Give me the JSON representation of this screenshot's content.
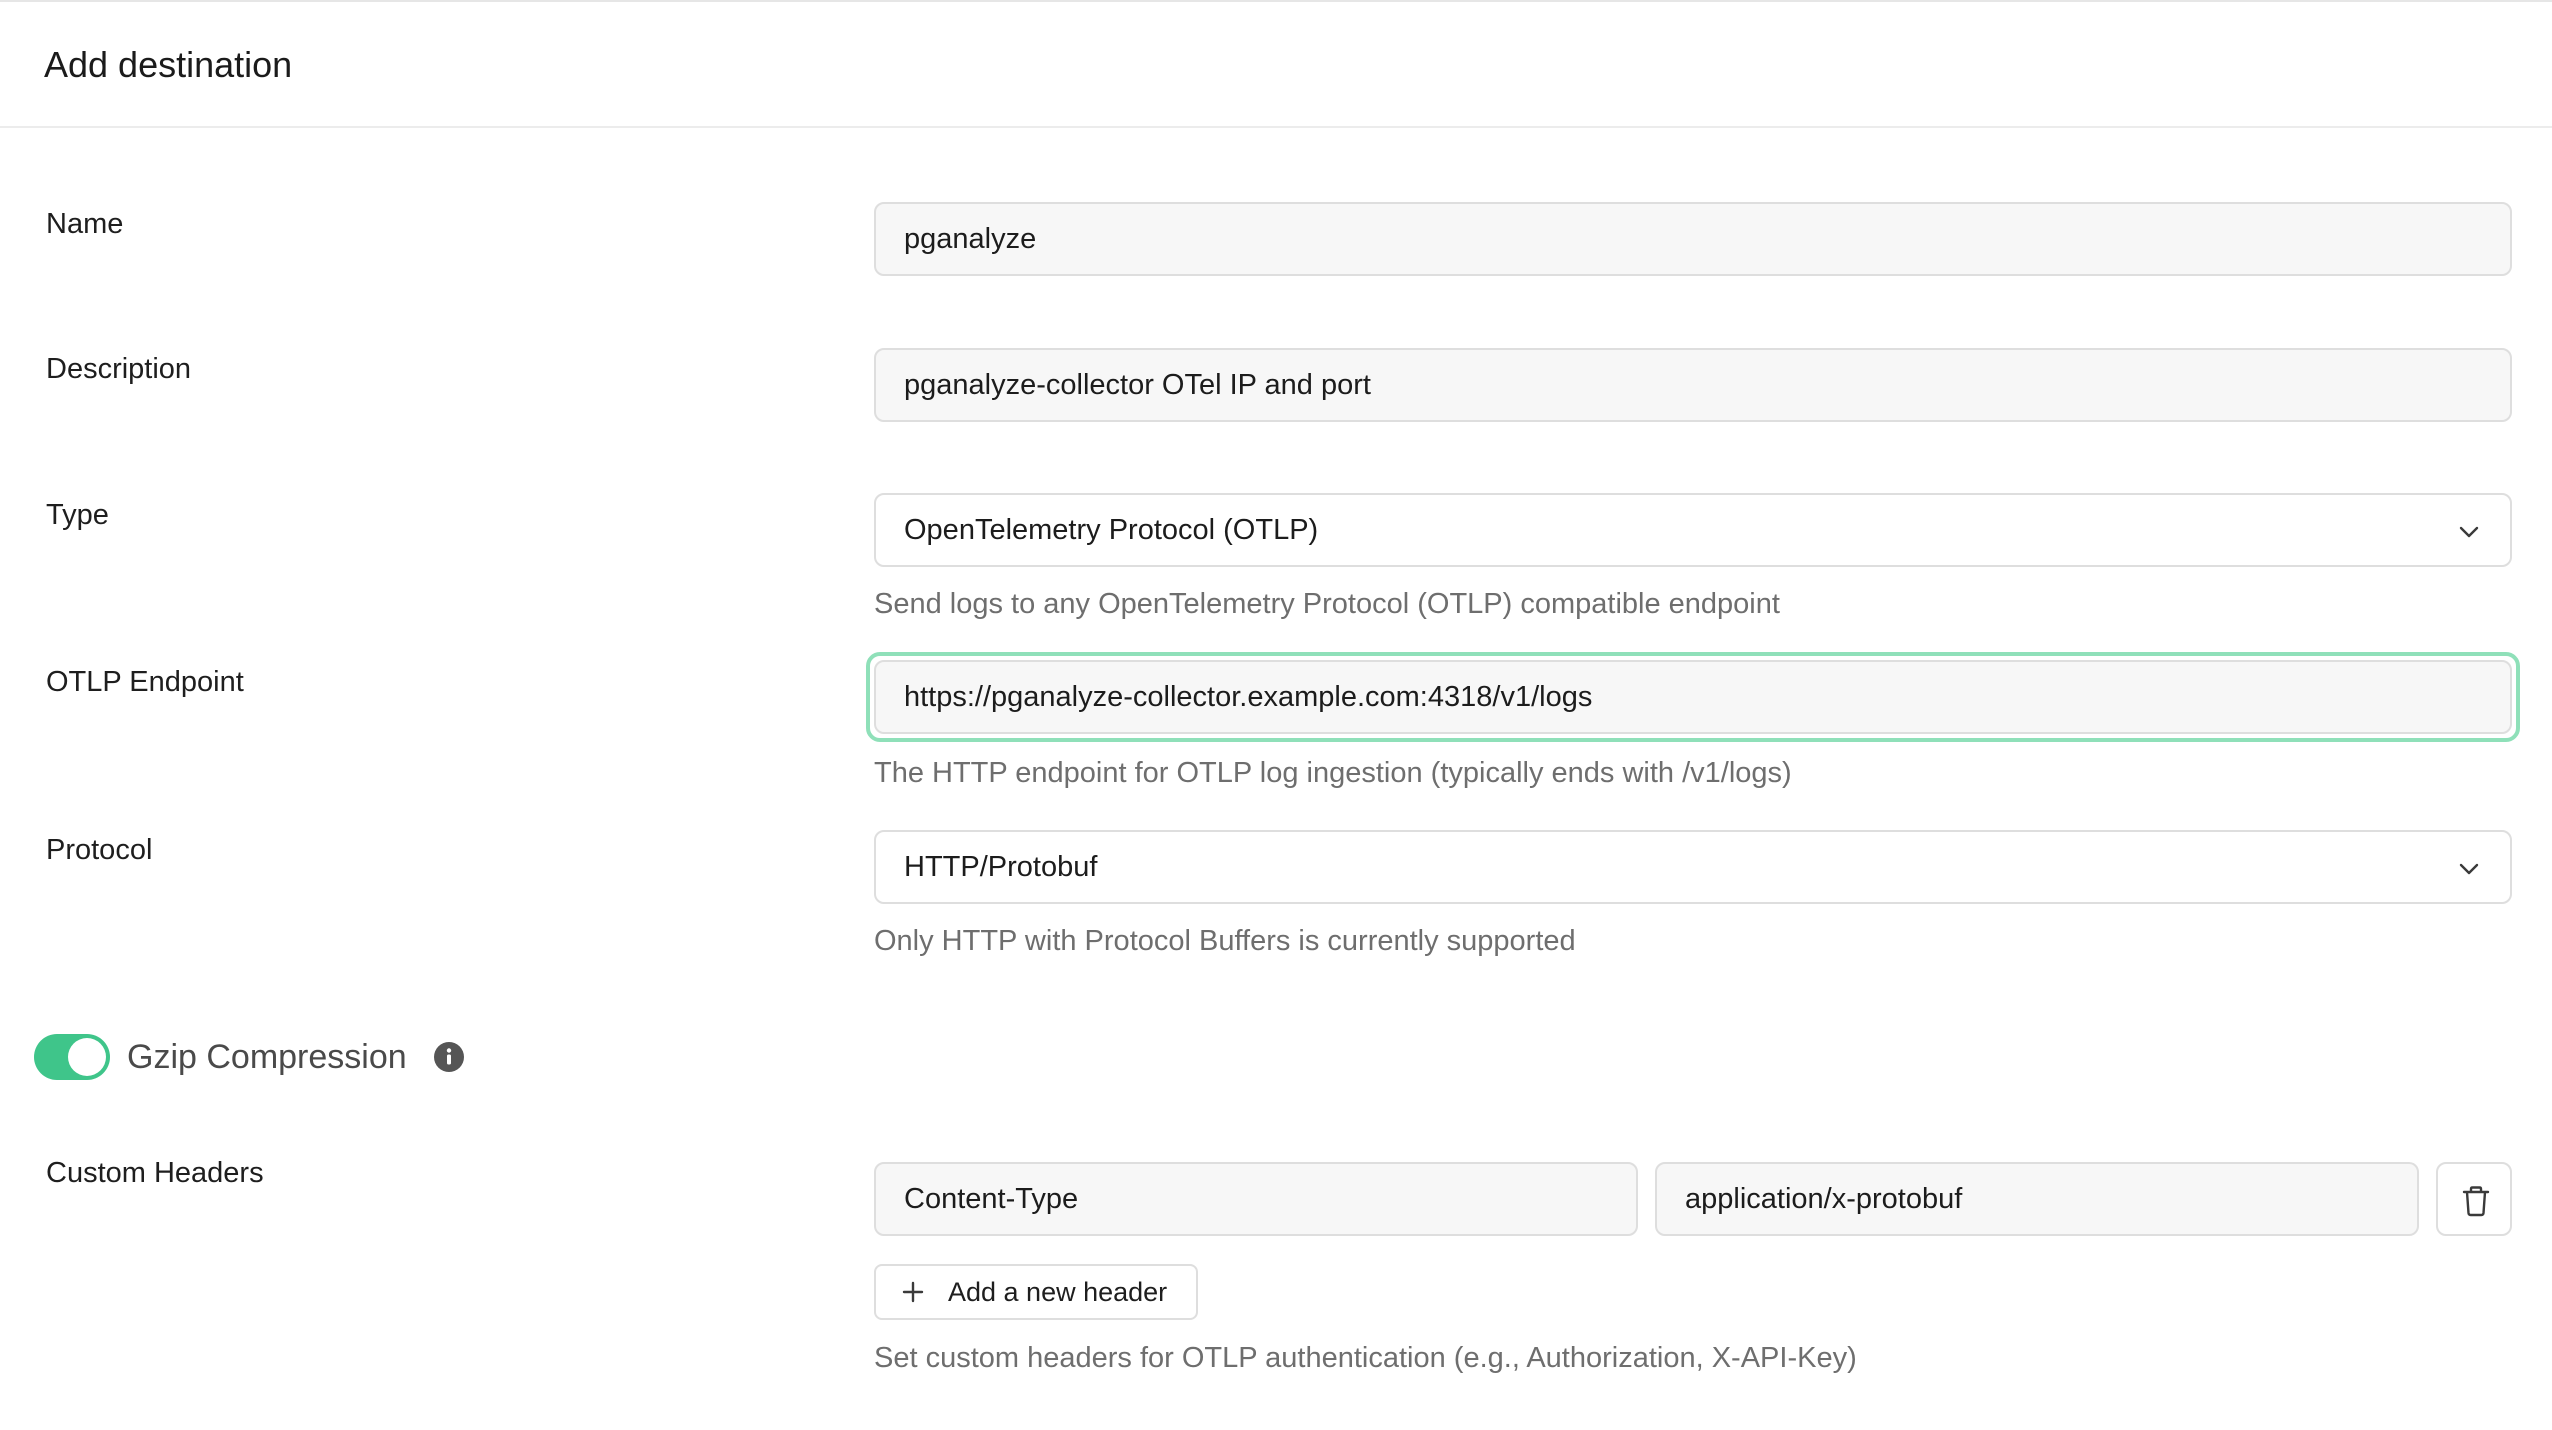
{
  "header": {
    "title": "Add destination"
  },
  "form": {
    "name": {
      "label": "Name",
      "value": "pganalyze"
    },
    "description": {
      "label": "Description",
      "value": "pganalyze-collector OTel IP and port"
    },
    "type": {
      "label": "Type",
      "selected": "OpenTelemetry Protocol (OTLP)",
      "hint": "Send logs to any OpenTelemetry Protocol (OTLP) compatible endpoint"
    },
    "endpoint": {
      "label": "OTLP Endpoint",
      "value": "https://pganalyze-collector.example.com:4318/v1/logs",
      "hint": "The HTTP endpoint for OTLP log ingestion (typically ends with /v1/logs)"
    },
    "protocol": {
      "label": "Protocol",
      "selected": "HTTP/Protobuf",
      "hint": "Only HTTP with Protocol Buffers is currently supported"
    },
    "gzip": {
      "label": "Gzip Compression",
      "enabled": true
    },
    "custom_headers": {
      "label": "Custom Headers",
      "rows": [
        {
          "key": "Content-Type",
          "value": "application/x-protobuf"
        }
      ],
      "add_label": "Add a new header",
      "hint": "Set custom headers for OTLP authentication (e.g., Authorization, X-API-Key)"
    }
  },
  "colors": {
    "accent": "#3fc58a",
    "focus_ring": "#8fe0b9",
    "field_bg": "#f7f7f7",
    "border": "#dedede",
    "hint_text": "#6e6e6e"
  },
  "icons": {
    "dropdown": "chevron-down-icon",
    "info": "info-icon",
    "delete": "trash-icon",
    "add": "plus-icon"
  }
}
